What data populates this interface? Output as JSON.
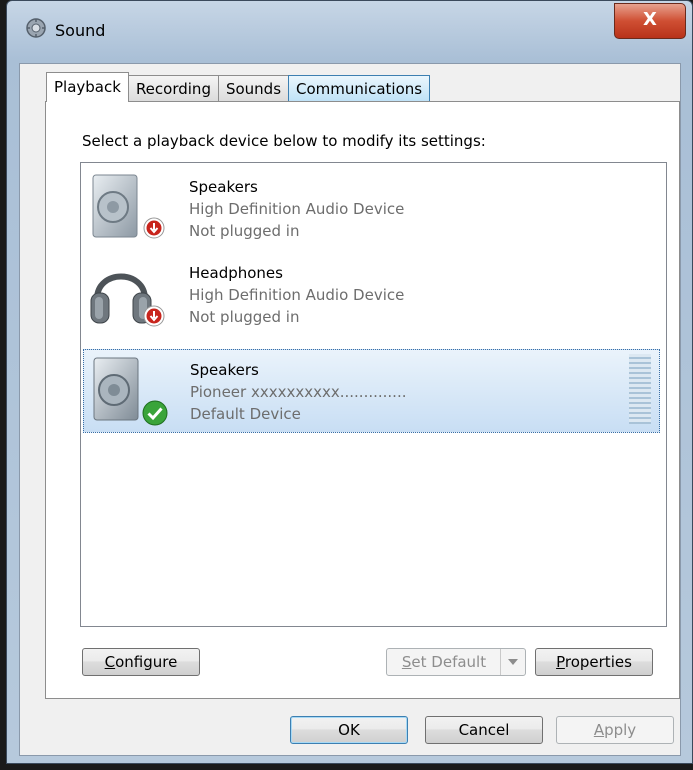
{
  "window": {
    "title": "Sound",
    "close_glyph": "X"
  },
  "tabs": [
    {
      "label": "Playback",
      "active": true
    },
    {
      "label": "Recording",
      "active": false
    },
    {
      "label": "Sounds",
      "active": false
    },
    {
      "label": "Communications",
      "active": false
    }
  ],
  "instruction": "Select a playback device below to modify its settings:",
  "devices": [
    {
      "name": "Speakers",
      "description": "High Definition Audio Device",
      "status": "Not plugged in",
      "icon": "speaker-icon",
      "badge": "unplugged-badge-icon"
    },
    {
      "name": "Headphones",
      "description": "High Definition Audio Device",
      "status": "Not plugged in",
      "icon": "headphones-icon",
      "badge": "unplugged-badge-icon"
    },
    {
      "name": "Speakers",
      "description": "Pioneer xxxxxxxxxx..............",
      "status": "Default Device",
      "icon": "speaker-icon",
      "badge": "default-check-icon",
      "selected": true
    }
  ],
  "buttons": {
    "configure": {
      "prefix": "",
      "accel": "C",
      "rest": "onfigure"
    },
    "set_default": {
      "prefix": "",
      "accel": "S",
      "rest": "et Default"
    },
    "properties": {
      "prefix": "",
      "accel": "P",
      "rest": "roperties"
    },
    "ok": "OK",
    "cancel": "Cancel",
    "apply": {
      "prefix": "",
      "accel": "A",
      "rest": "pply"
    }
  },
  "colors": {
    "accent": "#3c7fb1",
    "close": "#cf4f33",
    "default_check": "#3aa43a",
    "unplugged": "#c8241c"
  }
}
